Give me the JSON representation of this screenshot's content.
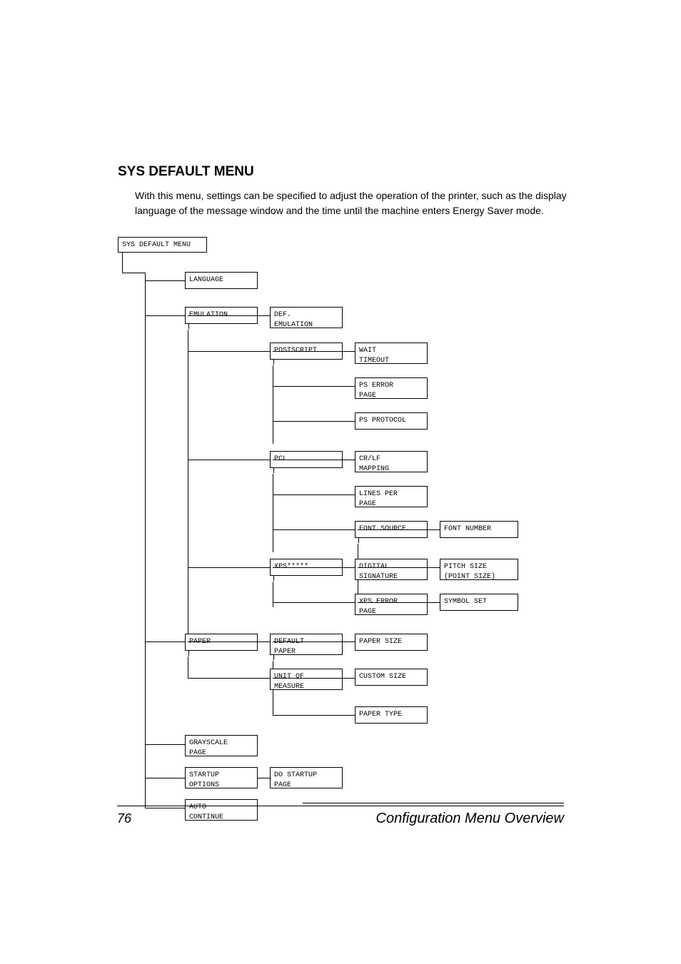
{
  "heading": "SYS DEFAULT MENU",
  "body_text": "With this menu, settings can be specified to adjust the operation of the printer, such as the display language of the message window and the time until the machine enters Energy Saver mode.",
  "tree": {
    "root": "SYS DEFAULT MENU",
    "l1": {
      "language": "LANGUAGE",
      "emulation": "EMULATION",
      "paper": "PAPER",
      "grayscale": "GRAYSCALE\nPAGE",
      "startup": "STARTUP\nOPTIONS",
      "autocont": "AUTO\nCONTINUE"
    },
    "emu": {
      "def": "DEF.\nEMULATION",
      "ps": "POSTSCRIPT",
      "pcl": "PCL",
      "xps": "XPS*****"
    },
    "ps": {
      "wait": "WAIT\nTIMEOUT",
      "pserr": "PS ERROR\nPAGE",
      "psproto": "PS PROTOCOL"
    },
    "pcl": {
      "crlf": "CR/LF\nMAPPING",
      "lpp": "LINES PER\nPAGE",
      "fontsrc": "FONT SOURCE"
    },
    "pcl_font": {
      "fontnum": "FONT NUMBER",
      "pitch": "PITCH SIZE\n(POINT SIZE)",
      "symbol": "SYMBOL SET"
    },
    "xps": {
      "digsig": "DIGITAL\nSIGNATURE",
      "xpserr": "XPS ERROR\nPAGE"
    },
    "paper": {
      "defpap": "DEFAULT\nPAPER",
      "unit": "UNIT OF\nMEASURE"
    },
    "paper_sub": {
      "papsize": "PAPER SIZE",
      "custsize": "CUSTOM SIZE",
      "paptype": "PAPER TYPE"
    },
    "startup": {
      "dostartup": "DO STARTUP\nPAGE"
    }
  },
  "footer": {
    "page_number": "76",
    "title": "Configuration Menu Overview"
  }
}
